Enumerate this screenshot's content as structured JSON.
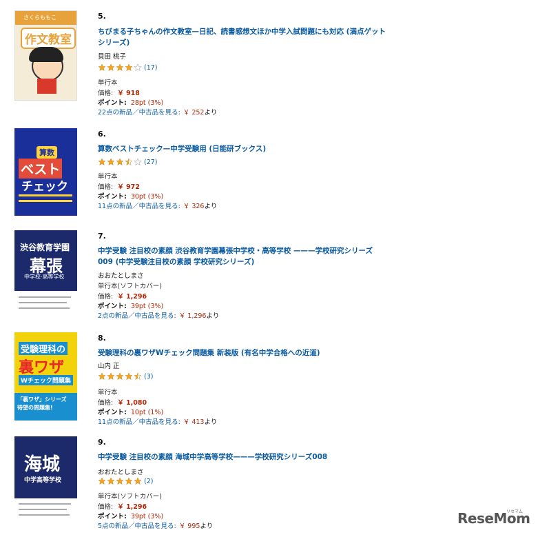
{
  "colors": {
    "link": "#0a5aa0",
    "price": "#b12704",
    "star": "#f4a41d"
  },
  "books": [
    {
      "rank": "5.",
      "title": "ちびまる子ちゃんの作文教室—日記、読書感想文ほか中学入試問題にも対応 (満点ゲットシリーズ)",
      "author": "貝田 桃子",
      "rating": 4,
      "review_count": "(17)",
      "format": "単行本",
      "price_label": "価格:",
      "price": "￥ 918",
      "points_label": "ポイント:",
      "points": "28pt (3%)",
      "offers_text": "22点の新品／中古品を見る:",
      "offers_price": "￥ 252",
      "offers_suffix": "より",
      "cover": {
        "top_text": "さくらももこ",
        "main_text": "作文教室"
      }
    },
    {
      "rank": "6.",
      "title": "算数ベストチェック—中学受験用 (日能研ブックス)",
      "author": "",
      "rating": 3.5,
      "review_count": "(27)",
      "format": "単行本",
      "price_label": "価格:",
      "price": "￥ 972",
      "points_label": "ポイント:",
      "points": "30pt (3%)",
      "offers_text": "11点の新品／中古品を見る:",
      "offers_price": "￥ 326",
      "offers_suffix": "より",
      "cover": {
        "line1": "算数",
        "line2": "ベスト",
        "line3": "チェック"
      }
    },
    {
      "rank": "7.",
      "title": "中学受験 注目校の素顔 渋谷教育学園幕張中学校・高等学校 ———学校研究シリーズ009 (中学受験注目校の素顔 学校研究シリーズ)",
      "author": "おおたとしまさ",
      "rating": 0,
      "review_count": "",
      "format": "単行本(ソフトカバー)",
      "price_label": "価格:",
      "price": "￥ 1,296",
      "points_label": "ポイント:",
      "points": "39pt (3%)",
      "offers_text": "2点の新品／中古品を見る:",
      "offers_price": "￥ 1,296",
      "offers_suffix": "より",
      "cover": {
        "line1": "渋谷教育学園",
        "line2": "幕張",
        "line3": "中学校·高等学校"
      }
    },
    {
      "rank": "8.",
      "title": "受験理科の裏ワザWチェック問題集 新装版 (有名中学合格への近道)",
      "author": "山内 正",
      "rating": 4.5,
      "review_count": "(3)",
      "format": "単行本",
      "price_label": "価格:",
      "price": "￥ 1,080",
      "points_label": "ポイント:",
      "points": "10pt (1%)",
      "offers_text": "11点の新品／中古品を見る:",
      "offers_price": "￥ 413",
      "offers_suffix": "より",
      "cover": {
        "line1": "受験理科の",
        "line2": "裏ワザ",
        "line3": "Wチェック問題集",
        "line4": "「裏ワザ」シリーズ",
        "line5": "待望の問題集!"
      }
    },
    {
      "rank": "9.",
      "title": "中学受験 注目校の素顔 海城中学高等学校———学校研究シリーズ008",
      "author": "おおたとしまさ",
      "rating": 5,
      "review_count": "(2)",
      "format": "単行本(ソフトカバー)",
      "price_label": "価格:",
      "price": "￥ 1,296",
      "points_label": "ポイント:",
      "points": "39pt (3%)",
      "offers_text": "5点の新品／中古品を見る:",
      "offers_price": "￥ 995",
      "offers_suffix": "より",
      "cover": {
        "line1": "海城",
        "line2": "中学高等学校"
      }
    }
  ],
  "watermark": {
    "logo": "ReseMom",
    "sub": "リセマム"
  }
}
